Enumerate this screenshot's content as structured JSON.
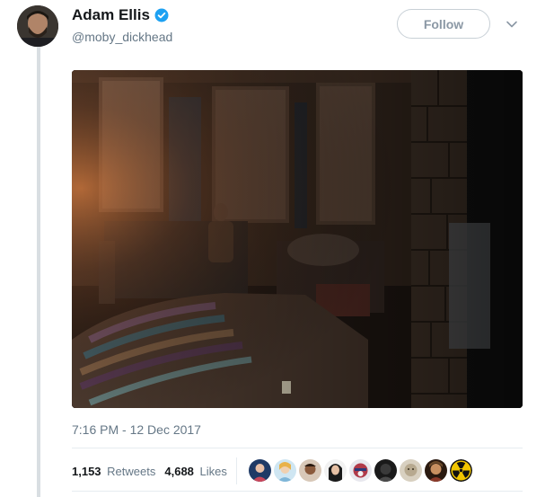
{
  "author": {
    "display_name": "Adam Ellis",
    "handle": "@moby_dickhead",
    "verified": true
  },
  "follow_button": {
    "label": "Follow"
  },
  "tweet": {
    "timestamp": "7:16 PM - 12 Dec 2017",
    "retweets": {
      "count": "1,153",
      "label": "Retweets"
    },
    "likes": {
      "count": "4,688",
      "label": "Likes"
    }
  },
  "likers": [
    {
      "name": "liker-avatar-1",
      "color": "#c9465a"
    },
    {
      "name": "liker-avatar-2",
      "color": "#7fb6d8"
    },
    {
      "name": "liker-avatar-3",
      "color": "#8a5a3c"
    },
    {
      "name": "liker-avatar-4",
      "color": "#2a2a2a"
    },
    {
      "name": "liker-avatar-5",
      "color": "#b03a4a"
    },
    {
      "name": "liker-avatar-6",
      "color": "#3a3a3a"
    },
    {
      "name": "liker-avatar-7",
      "color": "#b7a98f"
    },
    {
      "name": "liker-avatar-8",
      "color": "#6b4a2a"
    },
    {
      "name": "liker-avatar-9",
      "color": "#f2c600"
    }
  ],
  "colors": {
    "verified_blue": "#1da1f2",
    "muted_text": "#657786",
    "divider": "#e6ecf0"
  }
}
